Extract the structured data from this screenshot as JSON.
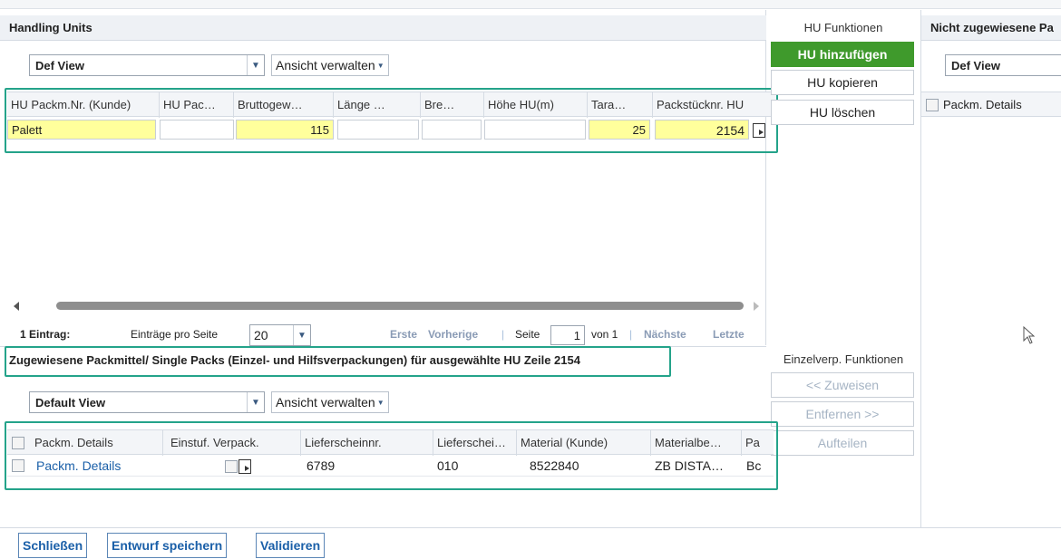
{
  "hu_panel": {
    "title": "Handling Units",
    "view_select": "Def View",
    "manage_view": "Ansicht verwalten",
    "columns": [
      "HU Packm.Nr. (Kunde)",
      "HU Pac…",
      "Bruttogew…",
      "Länge …",
      "Bre…",
      "Höhe HU(m)",
      "Tara…",
      "Packstücknr. HU"
    ],
    "row": {
      "packm": "Palett",
      "hu_pac": "",
      "bruttogew": "115",
      "laenge": "",
      "breite": "",
      "hoehe": "",
      "tara": "25",
      "packstuecknr": "2154"
    },
    "pager": {
      "count": "1 Eintrag:",
      "per_page_label": "Einträge pro Seite",
      "per_page": "20",
      "first": "Erste",
      "prev": "Vorherige",
      "page_label": "Seite",
      "page": "1",
      "of": "von 1",
      "next": "Nächste",
      "last": "Letzte"
    }
  },
  "hu_functions": {
    "title": "HU Funktionen",
    "add": "HU hinzufügen",
    "copy": "HU kopieren",
    "delete": "HU löschen"
  },
  "unassigned_panel": {
    "title": "Nicht zugewiesene Pa",
    "view_select": "Def View",
    "column": "Packm. Details"
  },
  "assigned_panel": {
    "title": "Zugewiesene Packmittel/ Single Packs (Einzel- und Hilfsverpackungen) für ausgewählte HU Zeile 2154",
    "view_select": "Default View",
    "manage_view": "Ansicht verwalten",
    "columns": [
      "Packm. Details",
      "Einstuf. Verpack.",
      "Lieferscheinnr.",
      "Lieferschei…",
      "Material (Kunde)",
      "Materialbe…",
      "Pa"
    ],
    "row": {
      "packm": "Packm. Details",
      "lieferscheinnr": "6789",
      "lieferschein_pos": "010",
      "material": "8522840",
      "materialbez": "ZB DISTA…",
      "pa": "Bc"
    }
  },
  "single_functions": {
    "title": "Einzelverp. Funktionen",
    "assign": "<< Zuweisen",
    "remove": "Entfernen >>",
    "split": "Aufteilen"
  },
  "footer": {
    "close": "Schließen",
    "save_draft": "Entwurf speichern",
    "validate": "Validieren"
  },
  "colors": {
    "accent_green": "#3f9a2c",
    "highlight": "#24a38a",
    "yellow": "#ffff9c"
  }
}
